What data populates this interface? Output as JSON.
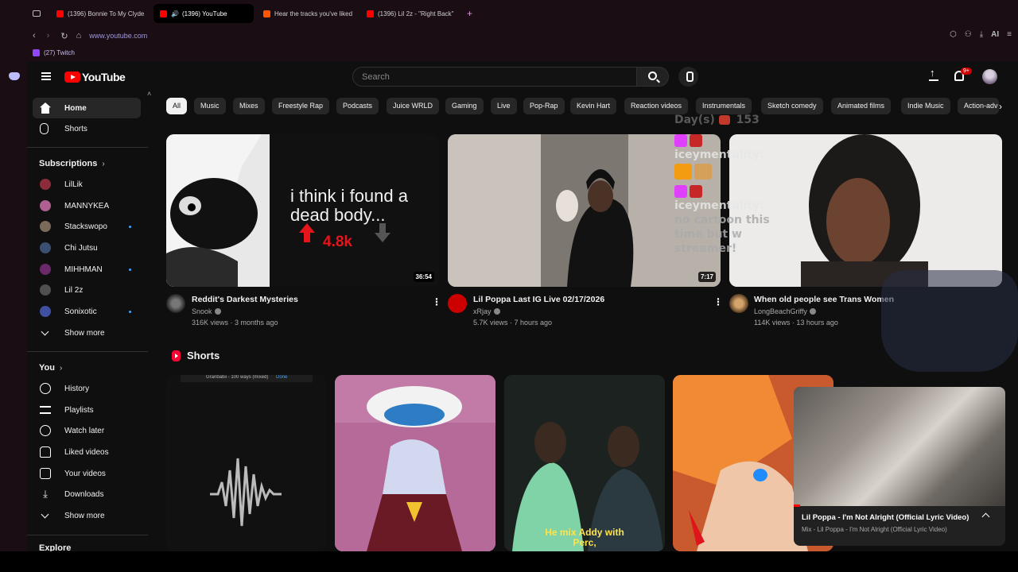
{
  "browser": {
    "tabs": [
      {
        "title": "(1396) Bonnie To My Clyde",
        "color": "#ff0000"
      },
      {
        "title": "(1396) YouTube",
        "color": "#ff0000",
        "active": true
      },
      {
        "title": "Hear the tracks you've liked",
        "color": "#ff5500"
      },
      {
        "title": "(1396) Lil 2z - \"Right Back\"",
        "color": "#ff0000"
      }
    ],
    "url": "www.youtube.com",
    "bookmark": "(27) Twitch",
    "extension_label": "AI"
  },
  "topbar": {
    "logo_text": "YouTube",
    "search_placeholder": "Search",
    "notification_badge": "9+"
  },
  "sidebar": {
    "main": [
      {
        "label": "Home",
        "active": true
      },
      {
        "label": "Shorts"
      }
    ],
    "subscriptions_title": "Subscriptions",
    "subscriptions": [
      {
        "label": "LilLik",
        "color": "#8b2c3a",
        "dot": false
      },
      {
        "label": "MANNYKEA",
        "color": "#b06090",
        "dot": false
      },
      {
        "label": "Stackswopo",
        "color": "#7a6a5a",
        "dot": true
      },
      {
        "label": "Chi Jutsu",
        "color": "#3a5070",
        "dot": false
      },
      {
        "label": "MIHHMAN",
        "color": "#6a2a6a",
        "dot": true
      },
      {
        "label": "Lil 2z",
        "color": "#505050",
        "dot": false
      },
      {
        "label": "Sonixotic",
        "color": "#4050a0",
        "dot": true
      }
    ],
    "show_more": "Show more",
    "you_title": "You",
    "you_items": [
      {
        "label": "History"
      },
      {
        "label": "Playlists"
      },
      {
        "label": "Watch later"
      },
      {
        "label": "Liked videos"
      },
      {
        "label": "Your videos"
      },
      {
        "label": "Downloads"
      }
    ],
    "show_more_2": "Show more",
    "explore_title": "Explore"
  },
  "chips": [
    "All",
    "Music",
    "Mixes",
    "Freestyle Rap",
    "Podcasts",
    "Juice WRLD",
    "Gaming",
    "Live",
    "Pop-Rap",
    "Kevin Hart",
    "Reaction videos",
    "Instrumentals",
    "Sketch comedy",
    "Animated films",
    "Indie Music",
    "Action-adv"
  ],
  "videos": [
    {
      "title": "Reddit's Darkest Mysteries",
      "channel": "Snook",
      "meta": "316K views · 3 months ago",
      "duration": "36:54",
      "thumb_text": "i think i found a dead body...",
      "thumb_count": "4.8k"
    },
    {
      "title": "Lil Poppa Last IG Live 02/17/2026",
      "channel": "xRjay",
      "meta": "5.7K views · 7 hours ago",
      "duration": "7:17"
    },
    {
      "title": "When old people see Trans Women",
      "channel": "LongBeachGriffy",
      "meta": "114K views · 13 hours ago"
    }
  ],
  "shorts": {
    "title": "Shorts",
    "first_short_caption": "Granbabii - 100 ways (mixed)",
    "first_short_done": "Done",
    "third_short_caption_1": "He mix Addy with",
    "third_short_caption_2": "Perc,"
  },
  "overlay_chat": {
    "line1": "Day(s)",
    "line1b": "153",
    "user1": "iceymentality:",
    "user2": "iceymentality:",
    "msg2": "no cartoon this time but w streamer!"
  },
  "miniplayer": {
    "title": "Lil Poppa - I'm Not Alright (Official Lyric Video)",
    "subtitle": "Mix - Lil Poppa - I'm Not Alright (Official Lyric Video)"
  }
}
